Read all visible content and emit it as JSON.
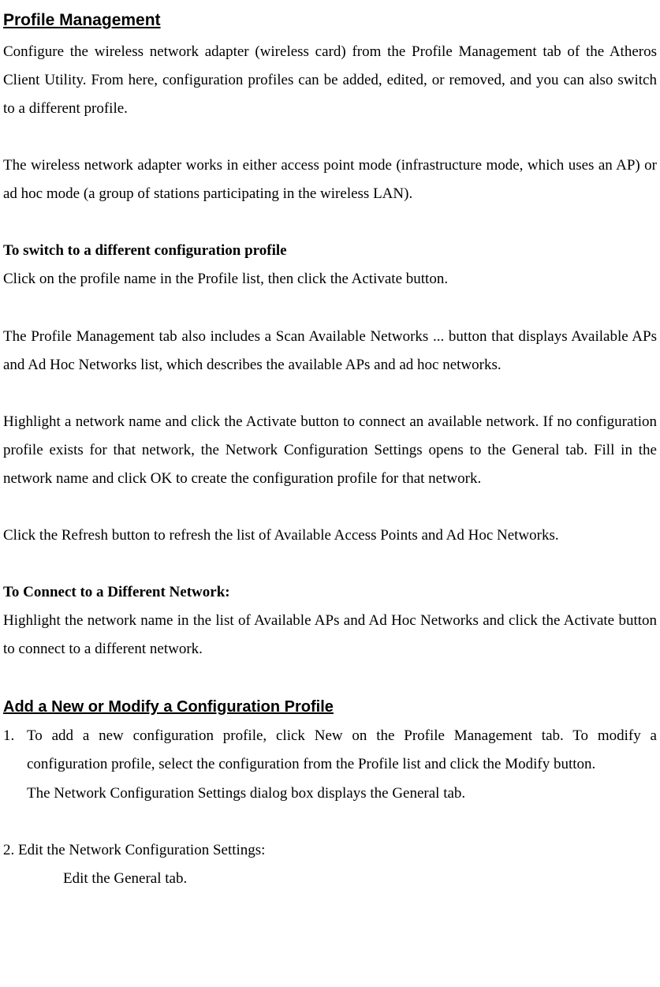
{
  "section1": {
    "heading": "Profile Management",
    "p1": "Configure the wireless network adapter (wireless card) from the Profile Management tab of the Atheros Client Utility.  From here, configuration profiles can be added, edited, or removed, and you can also switch to a different profile.",
    "p2": "The wireless network adapter works in either access point mode (infrastructure mode, which uses an AP) or ad hoc mode (a group of stations participating in the wireless LAN).",
    "sub1": "To switch to a different configuration profile",
    "p3": "Click on the profile name in the Profile list, then click the Activate button.",
    "p4": "The Profile Management tab also includes a Scan Available Networks ... button that displays Available APs and Ad Hoc Networks list, which describes the available APs and ad hoc networks.",
    "p5": "Highlight a network name and click the Activate button to connect an available network. If no configuration profile exists for that network, the Network Configuration Settings opens to the General tab.  Fill in the network name and click OK to create the configuration profile for that network.",
    "p6": "Click the Refresh button to refresh the list of Available Access Points and Ad Hoc Networks.",
    "sub2": "To Connect to a Different Network:",
    "p7": "Highlight the network name in the list of  Available APs and Ad Hoc Networks and click the Activate button to connect to a different network."
  },
  "section2": {
    "heading": "Add a New or Modify a Configuration Profile",
    "item1_marker": "1.",
    "item1a": "To add a new configuration profile, click New on the Profile Management tab. To modify a configuration profile, select the configuration from the Profile list and click the Modify button.",
    "item1b": "The Network Configuration Settings dialog box displays the General tab.",
    "item2": "2. Edit the Network Configuration Settings:",
    "item2a": "Edit the General tab."
  }
}
